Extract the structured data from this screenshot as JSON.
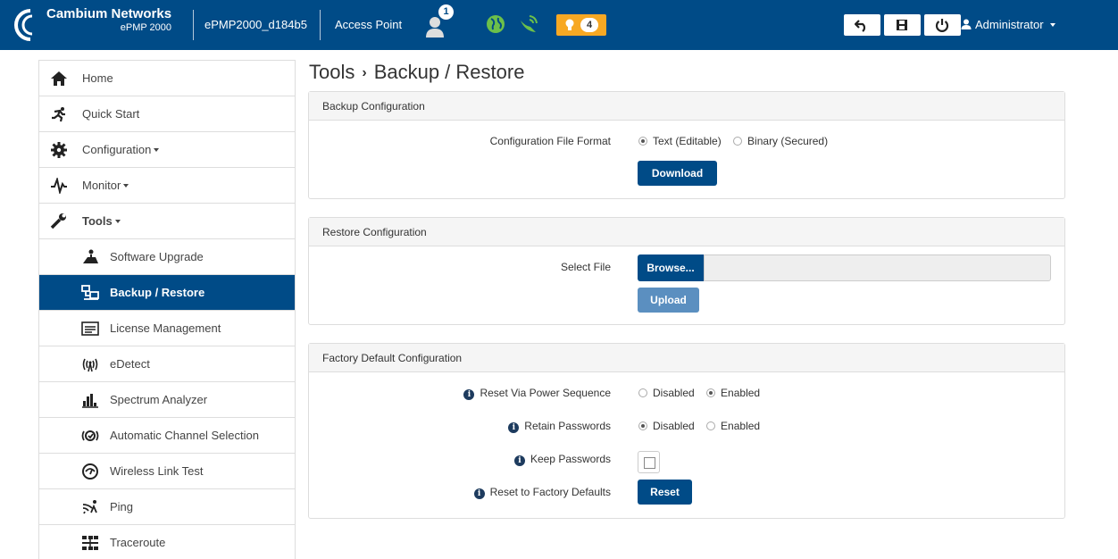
{
  "header": {
    "brand_name": "Cambium Networks",
    "brand_model": "ePMP 2000",
    "device_name": "ePMP2000_d184b5",
    "device_mode": "Access Point",
    "connected_users_count": "1",
    "alerts_count": "4",
    "user_label": "Administrator",
    "icons": [
      "cambium-logo-icon",
      "users-icon",
      "globe-icon",
      "satellite-icon",
      "lightbulb-icon",
      "undo-icon",
      "save-icon",
      "power-icon",
      "user-icon"
    ],
    "colors": {
      "bar": "#004b87",
      "alert": "#f7a823",
      "status_green": "#6cc04a"
    }
  },
  "sidebar": {
    "items": [
      {
        "label": "Home",
        "icon": "home-icon"
      },
      {
        "label": "Quick Start",
        "icon": "running-icon"
      },
      {
        "label": "Configuration",
        "icon": "gear-icon"
      },
      {
        "label": "Monitor",
        "icon": "pulse-icon"
      },
      {
        "label": "Tools",
        "icon": "wrench-icon"
      },
      {
        "label": "Software Upgrade",
        "icon": "upgrade-icon"
      },
      {
        "label": "Backup / Restore",
        "icon": "backup-icon"
      },
      {
        "label": "License Management",
        "icon": "license-icon"
      },
      {
        "label": "eDetect",
        "icon": "edetect-icon"
      },
      {
        "label": "Spectrum Analyzer",
        "icon": "bar-chart-icon"
      },
      {
        "label": "Automatic Channel Selection",
        "icon": "channel-select-icon"
      },
      {
        "label": "Wireless Link Test",
        "icon": "gauge-icon"
      },
      {
        "label": "Ping",
        "icon": "ping-icon"
      },
      {
        "label": "Traceroute",
        "icon": "traceroute-icon"
      }
    ],
    "active_color": "#004b87"
  },
  "page": {
    "title_parent": "Tools",
    "title_separator": "›",
    "title_current": "Backup / Restore"
  },
  "backup": {
    "heading": "Backup Configuration",
    "format_label": "Configuration File Format",
    "format_options": [
      "Text (Editable)",
      "Binary (Secured)"
    ],
    "format_selected": "Text (Editable)",
    "download_label": "Download"
  },
  "restore": {
    "heading": "Restore Configuration",
    "select_label": "Select File",
    "browse_label": "Browse...",
    "upload_label": "Upload"
  },
  "factory": {
    "heading": "Factory Default Configuration",
    "reset_power_label": "Reset Via Power Sequence",
    "reset_power_options": [
      "Disabled",
      "Enabled"
    ],
    "reset_power_selected": "Enabled",
    "retain_label": "Retain Passwords",
    "retain_options": [
      "Disabled",
      "Enabled"
    ],
    "retain_selected": "Disabled",
    "keep_label": "Keep Passwords",
    "keep_checked": false,
    "reset_label": "Reset to Factory Defaults",
    "reset_button": "Reset"
  }
}
